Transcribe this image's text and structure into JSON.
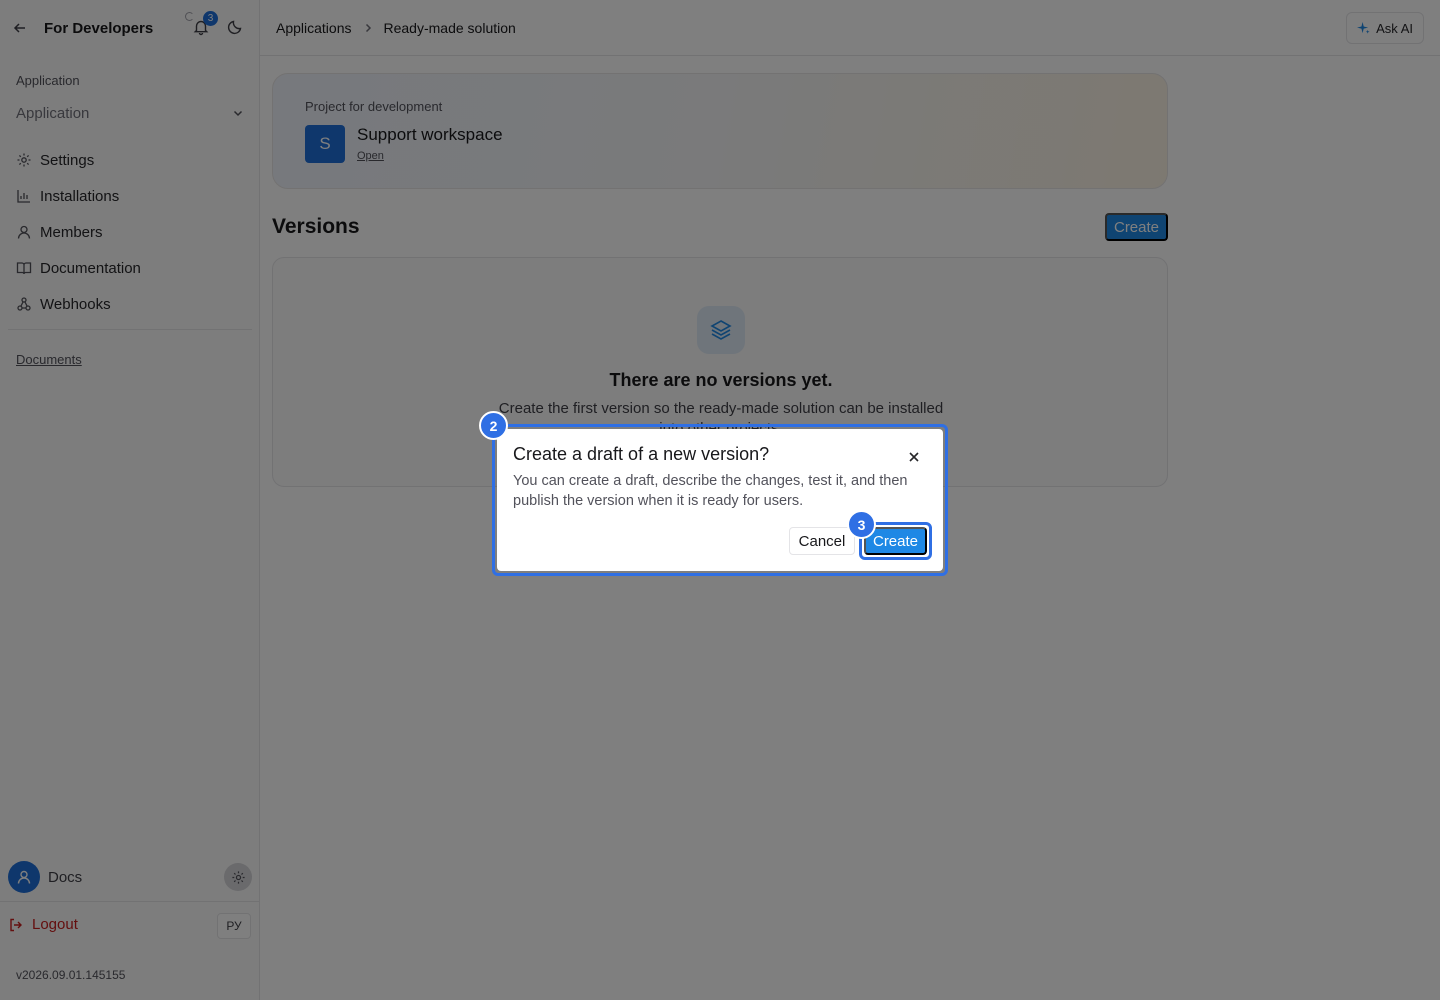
{
  "sidebar": {
    "title": "For Developers",
    "notifications_count": "3",
    "section_label": "Application",
    "app_select_value": "Application",
    "nav": [
      {
        "label": "Settings",
        "icon": "gear-icon"
      },
      {
        "label": "Installations",
        "icon": "bar-chart-icon"
      },
      {
        "label": "Members",
        "icon": "user-icon"
      },
      {
        "label": "Documentation",
        "icon": "book-icon"
      },
      {
        "label": "Webhooks",
        "icon": "webhook-icon"
      }
    ],
    "documents_link": "Documents",
    "user_name": "Docs",
    "logout_label": "Logout",
    "language": "РУ",
    "version": "v2026.09.01.145155"
  },
  "topbar": {
    "breadcrumbs": [
      "Applications",
      "Ready-made solution"
    ],
    "ask_ai_label": "Ask AI"
  },
  "project": {
    "label": "Project for development",
    "initial": "S",
    "name": "Support workspace",
    "open_link": "Open"
  },
  "versions": {
    "title": "Versions",
    "create_label": "Create",
    "empty_title": "There are no versions yet.",
    "empty_desc": "Create the first version so the ready-made solution can be installed into other projects."
  },
  "dialog": {
    "title": "Create a draft of a new version?",
    "body": "You can create a draft, describe the changes, test it, and then publish the version when it is ready for users.",
    "cancel_label": "Cancel",
    "create_label": "Create"
  },
  "steps": {
    "dialog_step": "2",
    "create_step": "3"
  },
  "colors": {
    "accent": "#1e88e5",
    "highlight": "#2f6fe4",
    "logout": "#c81e1e"
  }
}
